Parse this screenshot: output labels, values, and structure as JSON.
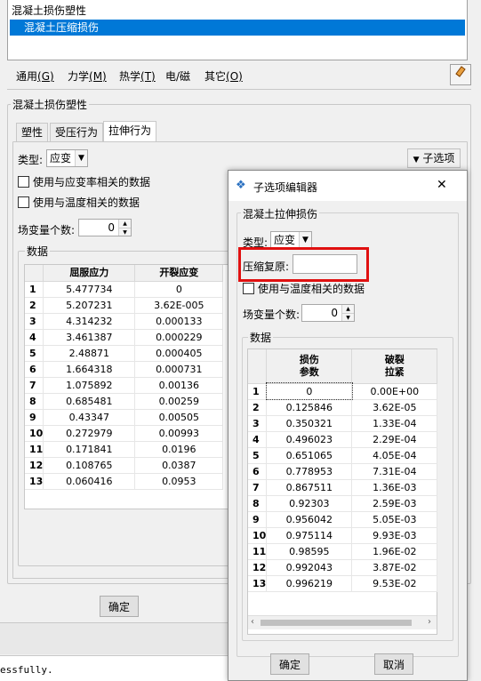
{
  "behavior_list": {
    "items": [
      "混凝土损伤塑性",
      "混凝土压缩损伤"
    ],
    "selected_index": 1
  },
  "menubar": {
    "items": [
      {
        "label": "通用",
        "key": "(G)"
      },
      {
        "label": "力学",
        "key": "(M)"
      },
      {
        "label": "热学",
        "key": "(T)"
      },
      {
        "label": "电/磁",
        "key": ""
      },
      {
        "label": "其它",
        "key": "(O)"
      }
    ],
    "eraser_icon": "eraser-icon"
  },
  "main": {
    "group_title": "混凝土损伤塑性",
    "tabs": [
      "塑性",
      "受压行为",
      "拉伸行为"
    ],
    "active_tab": 2,
    "type_label": "类型:",
    "type_value": "应变",
    "suboption_button": "子选项",
    "checkbox_rate": "使用与应变率相关的数据",
    "checkbox_temp": "使用与温度相关的数据",
    "field_vars_label": "场变量个数:",
    "field_vars_value": "0",
    "data_title": "数据",
    "table": {
      "headers": [
        "屈服应力",
        "开裂应变"
      ],
      "rows": [
        [
          "5.477734",
          "0"
        ],
        [
          "5.207231",
          "3.62E-005"
        ],
        [
          "4.314232",
          "0.000133"
        ],
        [
          "3.461387",
          "0.000229"
        ],
        [
          "2.48871",
          "0.000405"
        ],
        [
          "1.664318",
          "0.000731"
        ],
        [
          "1.075892",
          "0.00136"
        ],
        [
          "0.685481",
          "0.00259"
        ],
        [
          "0.43347",
          "0.00505"
        ],
        [
          "0.272979",
          "0.00993"
        ],
        [
          "0.171841",
          "0.0196"
        ],
        [
          "0.108765",
          "0.0387"
        ],
        [
          "0.060416",
          "0.0953"
        ]
      ]
    },
    "ok_button": "确定"
  },
  "dialog": {
    "title": "子选项编辑器",
    "close_glyph": "✕",
    "group_title": "混凝土拉伸损伤",
    "type_label": "类型:",
    "type_value": "应变",
    "recovery_label": "压缩复原:",
    "recovery_value": "",
    "checkbox_temp": "使用与温度相关的数据",
    "field_vars_label": "场变量个数:",
    "field_vars_value": "0",
    "data_title": "数据",
    "table": {
      "headers": [
        [
          "损伤",
          "参数"
        ],
        [
          "破裂",
          "拉紧"
        ]
      ],
      "rows": [
        [
          "0",
          "0.00E+00"
        ],
        [
          "0.125846",
          "3.62E-05"
        ],
        [
          "0.350321",
          "1.33E-04"
        ],
        [
          "0.496023",
          "2.29E-04"
        ],
        [
          "0.651065",
          "4.05E-04"
        ],
        [
          "0.778953",
          "7.31E-04"
        ],
        [
          "0.867511",
          "1.36E-03"
        ],
        [
          "0.92303",
          "2.59E-03"
        ],
        [
          "0.956042",
          "5.05E-03"
        ],
        [
          "0.975114",
          "9.93E-03"
        ],
        [
          "0.98595",
          "1.96E-02"
        ],
        [
          "0.992043",
          "3.87E-02"
        ],
        [
          "0.996219",
          "9.53E-02"
        ]
      ]
    },
    "ok_button": "确定",
    "cancel_button": "取消"
  },
  "status": {
    "message": "essfully."
  },
  "colors": {
    "selection": "#0078d7",
    "highlight": "#e01010"
  }
}
